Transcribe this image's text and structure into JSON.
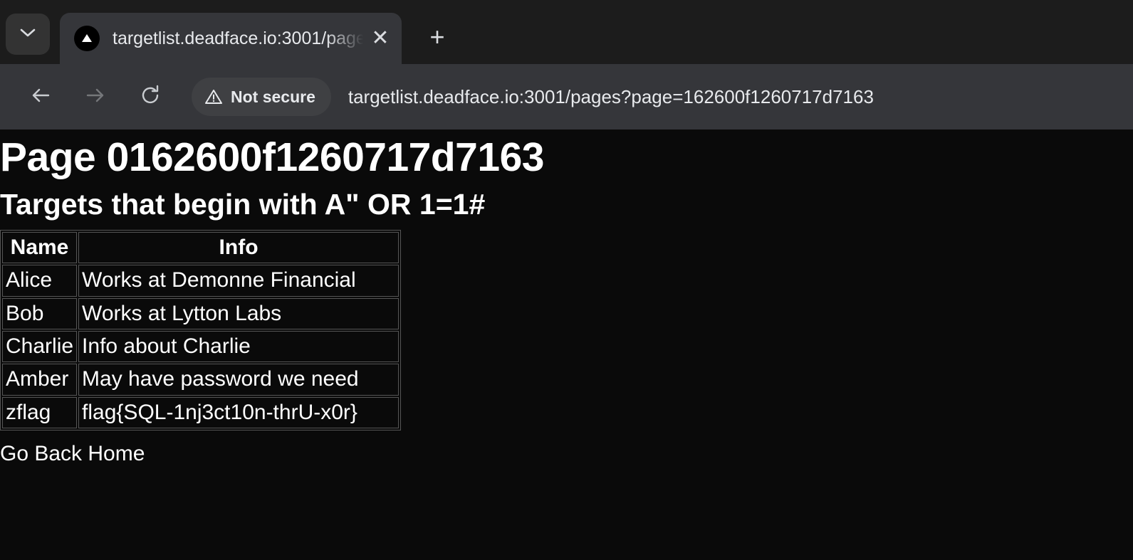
{
  "browser": {
    "tab_search_icon": "chevron-down-icon",
    "tab": {
      "favicon": "triangle-favicon",
      "title": "targetlist.deadface.io:3001/page",
      "close_label": "✕"
    },
    "new_tab_label": "+",
    "toolbar": {
      "back_icon": "arrow-left-icon",
      "forward_icon": "arrow-right-icon",
      "reload_icon": "reload-icon",
      "security_icon": "warning-triangle-icon",
      "security_label": "Not secure",
      "url": "targetlist.deadface.io:3001/pages?page=162600f1260717d7163"
    }
  },
  "page": {
    "title": "Page 0162600f1260717d7163",
    "subtitle": "Targets that begin with A\" OR 1=1#",
    "table": {
      "headers": [
        "Name",
        "Info"
      ],
      "rows": [
        {
          "name": "Alice",
          "info": "Works at Demonne Financial"
        },
        {
          "name": "Bob",
          "info": "Works at Lytton Labs"
        },
        {
          "name": "Charlie",
          "info": "Info about Charlie"
        },
        {
          "name": "Amber",
          "info": "May have password we need"
        },
        {
          "name": "zflag",
          "info": "flag{SQL-1nj3ct10n-thrU-x0r}"
        }
      ]
    },
    "back_link": "Go Back Home"
  },
  "colors": {
    "page_background": "#0a0a0a",
    "page_text": "#ffffff",
    "table_border": "#565656",
    "tabstrip": "#1c1c1c",
    "toolbar": "#35363a",
    "chrome_text": "#e8eaed"
  }
}
